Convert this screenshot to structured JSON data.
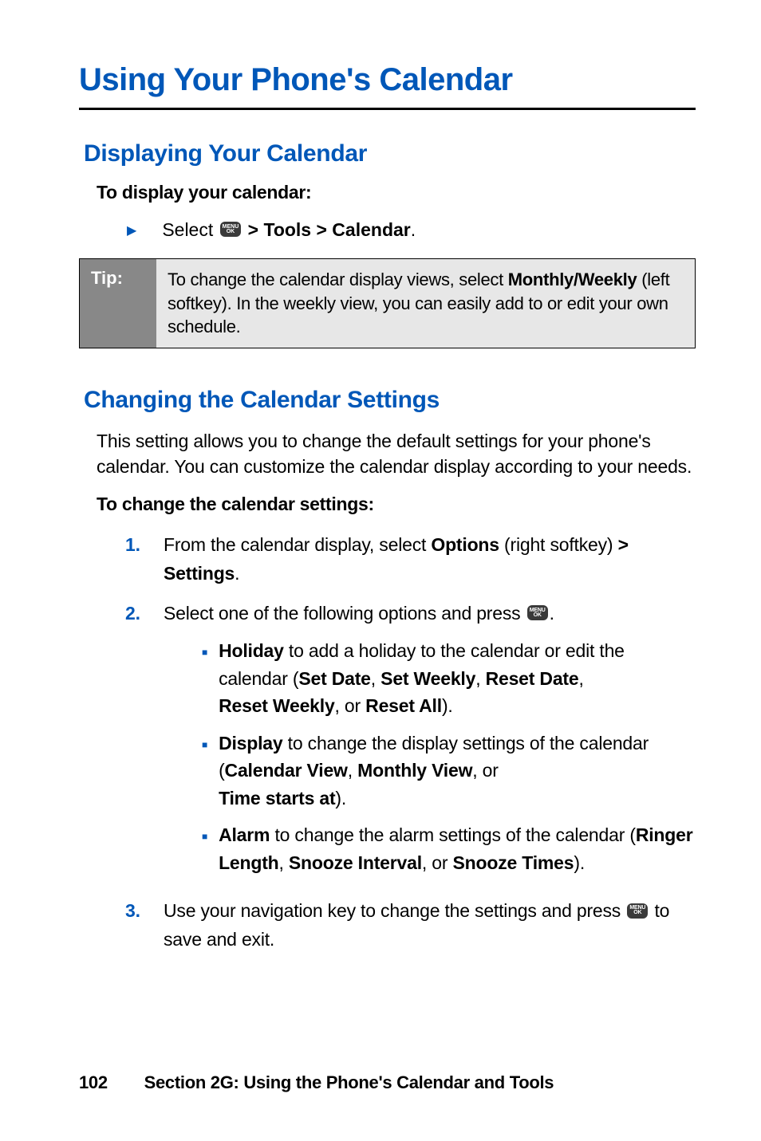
{
  "page_title": "Using Your Phone's Calendar",
  "section1": {
    "heading": "Displaying Your Calendar",
    "sub_heading": "To display your calendar:",
    "bullet_prefix": "Select ",
    "bullet_suffix": " > Tools > Calendar",
    "bullet_period": "."
  },
  "tip": {
    "label": "Tip:",
    "prefix": "To change the calendar display views, select ",
    "bold": "Monthly/Weekly",
    "suffix": " (left softkey). In the weekly view, you can easily add to or edit your own schedule."
  },
  "section2": {
    "heading": "Changing the Calendar Settings",
    "intro": "This setting allows you to change the default settings for your phone's calendar. You can customize the calendar display according to your needs.",
    "sub_heading": "To change the calendar settings:",
    "items": {
      "1": {
        "num": "1.",
        "p1": "From the calendar display, select ",
        "b1": "Options",
        "p2": " (right softkey) ",
        "b2": "> Settings",
        "p3": "."
      },
      "2": {
        "num": "2.",
        "p1": "Select one of the following options and press ",
        "p2": ".",
        "sub": {
          "a": {
            "b1": "Holiday",
            "t1": " to add a holiday to the calendar or edit the calendar (",
            "b2": "Set Date",
            "c1": ", ",
            "b3": "Set Weekly",
            "c2": ", ",
            "b4": "Reset Date",
            "c3": ", ",
            "b5": "Reset Weekly",
            "c4": ", or ",
            "b6": "Reset All",
            "t2": ")."
          },
          "b": {
            "b1": "Display",
            "t1": " to change the display settings of the calendar (",
            "b2": "Calendar View",
            "c1": ", ",
            "b3": "Monthly View",
            "c2": ", or ",
            "b4": "Time starts at",
            "t2": ")."
          },
          "c": {
            "b1": "Alarm",
            "t1": " to change the alarm settings of the calendar (",
            "b2": "Ringer Length",
            "c1": ", ",
            "b3": "Snooze Interval",
            "c2": ", or ",
            "b4": "Snooze Times",
            "t2": ")."
          }
        }
      },
      "3": {
        "num": "3.",
        "p1": "Use your navigation key to change the settings and press ",
        "p2": " to save and exit."
      }
    }
  },
  "footer": {
    "page": "102",
    "section": "Section 2G: Using the Phone's Calendar and Tools"
  },
  "icon": {
    "line1": "MENU",
    "line2": "OK"
  }
}
